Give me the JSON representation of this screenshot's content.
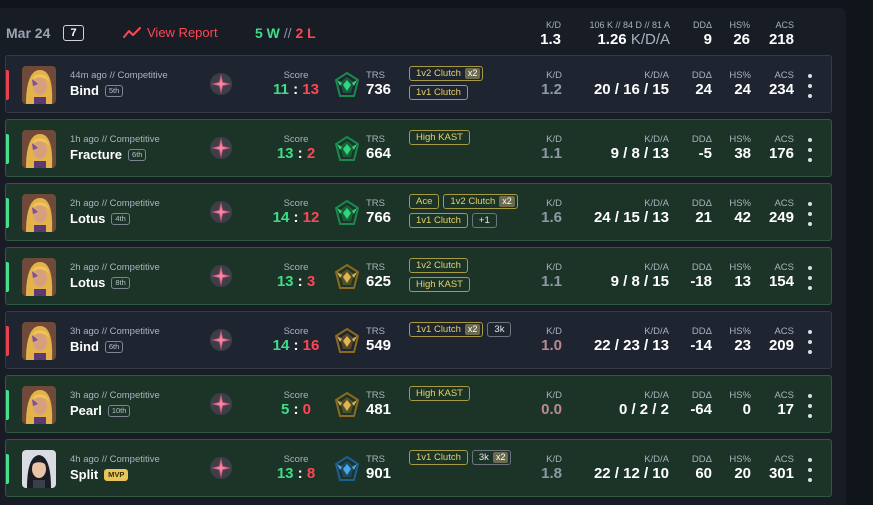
{
  "header": {
    "date": "Mar 24",
    "match_count": "7",
    "view_report": "View Report",
    "wins": "5 W",
    "sep": "//",
    "losses": "2 L",
    "kd_label": "K/D",
    "kd_value": "1.3",
    "kda_label": "106 K // 84 D // 81 A",
    "kda_value": "1.26",
    "kda_suffix": "K/D/A",
    "dd_label": "DDΔ",
    "dd_value": "9",
    "hs_label": "HS%",
    "hs_value": "26",
    "acs_label": "ACS",
    "acs_value": "218"
  },
  "labels": {
    "score": "Score",
    "trs": "TRS",
    "kd": "K/D",
    "kda": "K/D/A",
    "dd": "DDΔ",
    "hs": "HS%",
    "acs": "ACS"
  },
  "colors": {
    "win": "#3fdc89",
    "loss": "#ff4655",
    "badge": "#e4d26a",
    "accent": "#ff4655"
  },
  "matches": [
    {
      "result": "loss",
      "ago": "44m ago // Competitive",
      "map": "Bind",
      "place": "5th",
      "mvp": false,
      "agent": "gold-hair-agent",
      "score_us": "11",
      "score_them": "13",
      "trs": "736",
      "trs_tier": "green",
      "badges": [
        [
          {
            "t": "1v2 Clutch",
            "m": "x2"
          }
        ],
        [
          {
            "t": "1v1 Clutch"
          }
        ]
      ],
      "kd": "1.2",
      "kd_style": "muted",
      "kda": "20 / 16 / 15",
      "dd": "24",
      "hs": "24",
      "acs": "234"
    },
    {
      "result": "win",
      "ago": "1h ago // Competitive",
      "map": "Fracture",
      "place": "6th",
      "mvp": false,
      "agent": "gold-hair-agent",
      "score_us": "13",
      "score_them": "2",
      "trs": "664",
      "trs_tier": "green",
      "badges": [
        [
          {
            "t": "High KAST"
          }
        ]
      ],
      "kd": "1.1",
      "kd_style": "muted",
      "kda": "9 / 8 / 13",
      "dd": "-5",
      "hs": "38",
      "acs": "176"
    },
    {
      "result": "win",
      "ago": "2h ago // Competitive",
      "map": "Lotus",
      "place": "4th",
      "mvp": false,
      "agent": "gold-hair-agent",
      "score_us": "14",
      "score_them": "12",
      "trs": "766",
      "trs_tier": "green",
      "badges": [
        [
          {
            "t": "Ace"
          },
          {
            "t": "1v2 Clutch",
            "m": "x2"
          }
        ],
        [
          {
            "t": "1v1 Clutch"
          },
          {
            "t": "+1",
            "plain": true
          }
        ]
      ],
      "kd": "1.6",
      "kd_style": "muted",
      "kda": "24 / 15 / 13",
      "dd": "21",
      "hs": "42",
      "acs": "249"
    },
    {
      "result": "win",
      "ago": "2h ago // Competitive",
      "map": "Lotus",
      "place": "8th",
      "mvp": false,
      "agent": "gold-hair-agent",
      "score_us": "13",
      "score_them": "3",
      "trs": "625",
      "trs_tier": "gold",
      "badges": [
        [
          {
            "t": "1v2 Clutch"
          }
        ],
        [
          {
            "t": "High KAST"
          }
        ]
      ],
      "kd": "1.1",
      "kd_style": "muted",
      "kda": "9 / 8 / 15",
      "dd": "-18",
      "hs": "13",
      "acs": "154"
    },
    {
      "result": "loss",
      "ago": "3h ago // Competitive",
      "map": "Bind",
      "place": "6th",
      "mvp": false,
      "agent": "gold-hair-agent",
      "score_us": "14",
      "score_them": "16",
      "trs": "549",
      "trs_tier": "gold",
      "badges": [
        [
          {
            "t": "1v1 Clutch",
            "m": "x2"
          },
          {
            "t": "3k",
            "plain": true
          }
        ]
      ],
      "kd": "1.0",
      "kd_style": "bad",
      "kda": "22 / 23 / 13",
      "dd": "-14",
      "hs": "23",
      "acs": "209"
    },
    {
      "result": "win",
      "ago": "3h ago // Competitive",
      "map": "Pearl",
      "place": "10th",
      "mvp": false,
      "agent": "gold-hair-agent",
      "score_us": "5",
      "score_them": "0",
      "trs": "481",
      "trs_tier": "gold",
      "badges": [
        [
          {
            "t": "High KAST"
          }
        ]
      ],
      "kd": "0.0",
      "kd_style": "bad",
      "kda": "0 / 2 / 2",
      "dd": "-64",
      "hs": "0",
      "acs": "17"
    },
    {
      "result": "win",
      "ago": "4h ago // Competitive",
      "map": "Split",
      "place": "MVP",
      "mvp": true,
      "agent": "dark-hair-agent",
      "score_us": "13",
      "score_them": "8",
      "trs": "901",
      "trs_tier": "blue",
      "badges": [
        [
          {
            "t": "1v1 Clutch"
          },
          {
            "t": "3k",
            "m": "x2",
            "plain": true
          }
        ]
      ],
      "kd": "1.8",
      "kd_style": "muted",
      "kda": "22 / 12 / 10",
      "dd": "60",
      "hs": "20",
      "acs": "301"
    }
  ]
}
